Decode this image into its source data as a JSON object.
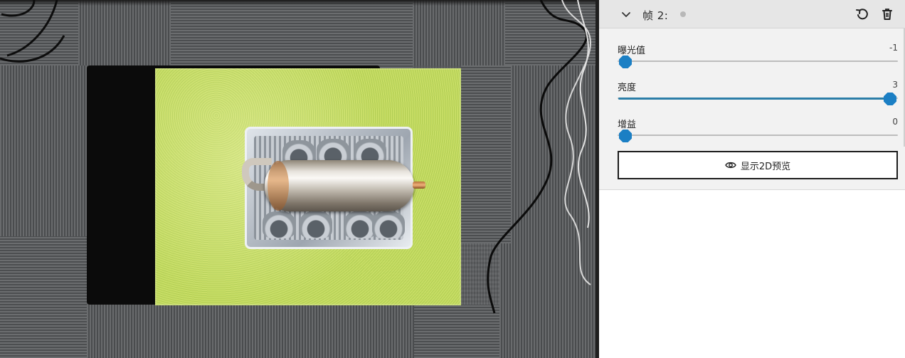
{
  "frame": {
    "title": "帧 2:",
    "icons": {
      "collapse": "chevron-down-icon",
      "reset": "undo-icon",
      "delete": "trash-icon",
      "status": "status-dot"
    }
  },
  "params": [
    {
      "label": "曝光值",
      "value": "-1",
      "fraction": 0.0
    },
    {
      "label": "亮度",
      "value": "3",
      "fraction": 1.0
    },
    {
      "label": "增益",
      "value": "0",
      "fraction": 0.0
    }
  ],
  "preview_button": {
    "label": "显示2D预览",
    "icon": "eye-icon"
  },
  "colors": {
    "accent": "#1b7fc4",
    "track_fill": "#2c7ea8",
    "panel_bg": "#f2f2f2",
    "header_bg": "#e6e6e6"
  }
}
